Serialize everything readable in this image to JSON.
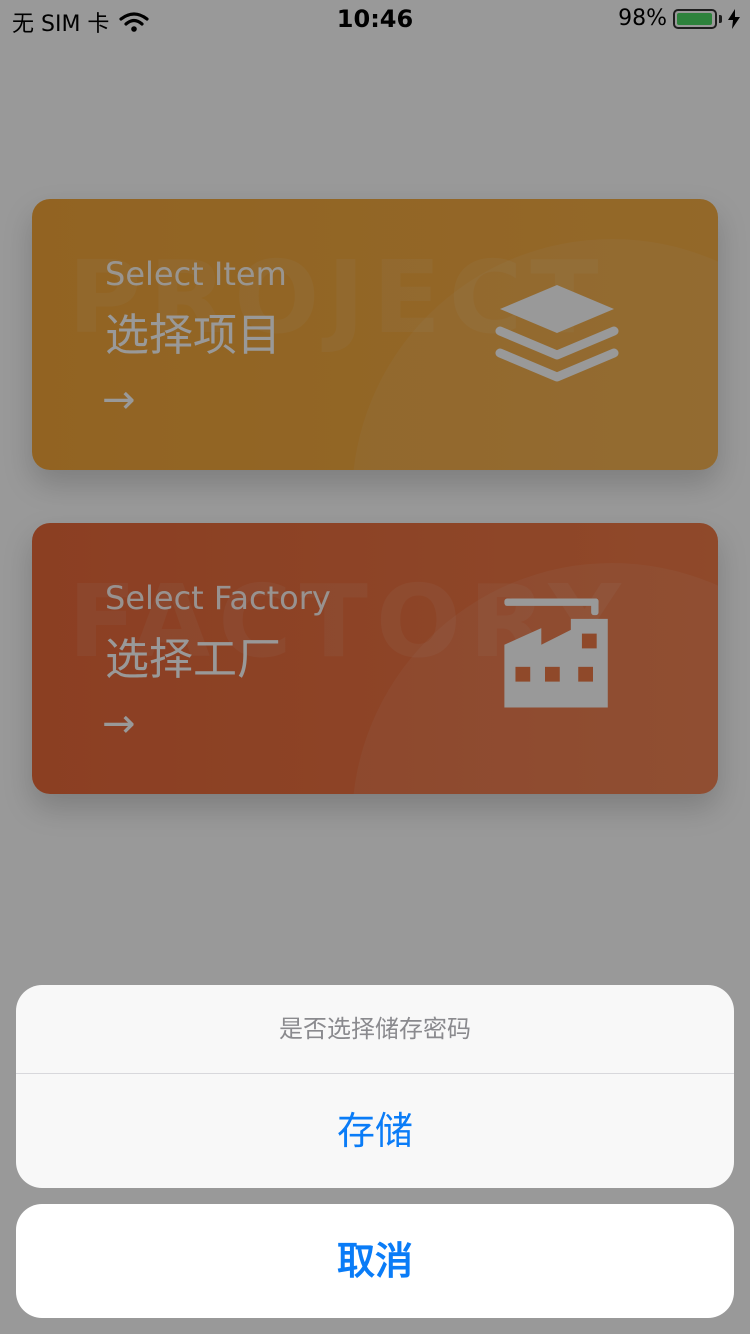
{
  "status_bar": {
    "carrier": "无 SIM 卡",
    "time": "10:46",
    "battery_percent": "98%",
    "battery_level": 0.98,
    "wifi_icon": "wifi-icon",
    "charging_icon": "bolt-icon"
  },
  "cards": [
    {
      "watermark": "PROJECT",
      "subtitle": "Select Item",
      "title": "选择项目",
      "arrow": "→",
      "icon": "layers-icon",
      "color": "#f3a63a"
    },
    {
      "watermark": "FACTORY",
      "subtitle": "Select Factory",
      "title": "选择工厂",
      "arrow": "→",
      "icon": "factory-icon",
      "color": "#e8693a"
    }
  ],
  "action_sheet": {
    "title": "是否选择储存密码",
    "action_label": "存储",
    "cancel_label": "取消",
    "action_color": "#0a7cf7"
  }
}
